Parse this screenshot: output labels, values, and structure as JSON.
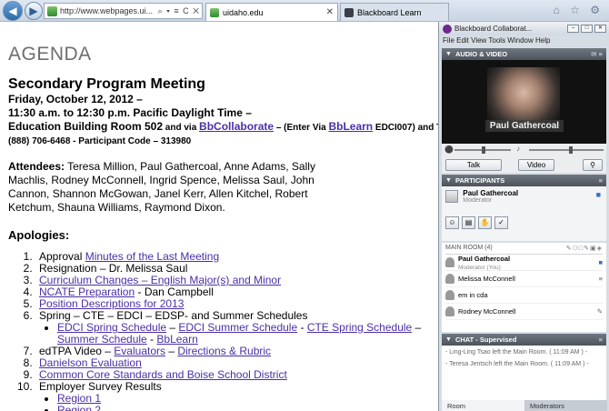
{
  "browser": {
    "back_icon": "back-arrow-icon",
    "forward_icon": "forward-arrow-icon",
    "address": "http://www.webpages.ui...",
    "address_controls": "⌕ ▾ ≡ C ✕",
    "tabs": [
      {
        "label": "uidaho.edu",
        "close": "✕"
      },
      {
        "label": "Blackboard Learn"
      }
    ],
    "toolbar_icons": "⌂ ☆ ⚙"
  },
  "page": {
    "title": "AGENDA",
    "meeting_title": "Secondary Program Meeting",
    "date_line": "Friday, October 12, 2012 –",
    "time_line": "11:30 a.m. to 12:30 p.m. Pacific Daylight Time –",
    "location_prefix": "Education Building Room 502",
    "location_via": " and via ",
    "location_link1": "BbCollaborate",
    "location_mid": " – (Enter Via ",
    "location_link2": "BbLearn",
    "location_suffix": " EDCI007) and T",
    "phone_line": "(888) 706-6468 - Participant Code – 313980",
    "attendees_label": "Attendees:",
    "attendees_text": " Teresa Million, Paul Gathercoal, Anne Adams, Sally Machlis, Rodney McConnell, Ingrid Spence, Melissa Saul, John Cannon, Shannon McGowan, Janel Kerr, Allen Kitchel, Robert Ketchum, Shauna Williams, Raymond Dixon.",
    "apologies_title": "Apologies:",
    "items": {
      "i1_text": "Approval ",
      "i1_link": "Minutes of the Last Meeting",
      "i2_text": "Resignation – Dr. Melissa Saul",
      "i3_link": "Curriculum Changes – English Major(s) and Minor",
      "i4_link": "NCATE Preparation",
      "i4_text": " - Dan Campbell",
      "i5_link": "Position Descriptions for 2013",
      "i6_text": "Spring – CTE – EDCI – EDSP- and Summer Schedules",
      "i6_sub_link1": "EDCI Spring Schedule",
      "i6_sep1": " – ",
      "i6_sub_link2": "EDCI Summer Schedule",
      "i6_sep2": " - ",
      "i6_sub_link3": "CTE Spring Schedule",
      "i6_sep3": " – ",
      "i6_sub_link4": "Summer Schedule",
      "i6_sep4": " - ",
      "i6_sub_link5": "BbLearn",
      "i7_text": "edTPA Video – ",
      "i7_link1": "Evaluators",
      "i7_sep": " – ",
      "i7_link2": "Directions & Rubric",
      "i8_link": "Danielson Evaluation",
      "i9_link": "Common Core Standards and Boise School District",
      "i10_text": "Employer Survey Results",
      "i10_sub1": "Region 1",
      "i10_sub2": "Region 2"
    }
  },
  "collaborate": {
    "window_title": "Blackboard Collaborat...",
    "menu": "File  Edit  View  Tools  Window  Help",
    "audio_video_hdr": "AUDIO & VIDEO",
    "video_name": "Paul Gathercoal",
    "talk": "Talk",
    "video": "Video",
    "participants_hdr": "PARTICIPANTS",
    "moderator_name": "Paul Gathercoal",
    "moderator_role": "Moderator",
    "main_room": "MAIN ROOM (4)",
    "room_participants": [
      {
        "name": "Paul Gathercoal",
        "role": "Moderator (You)"
      },
      {
        "name": "Melissa McConnell",
        "role": ""
      },
      {
        "name": "em in cda",
        "role": ""
      },
      {
        "name": "Rodney McConnell",
        "role": ""
      }
    ],
    "chat_hdr": "CHAT - Supervised",
    "chat_messages": [
      "- Ling-Ling Tsao left the Main Room. ( 11:09 AM ) -",
      "- Teresa Jentsch left the Main Room. ( 11:09 AM ) -"
    ],
    "bottom_tabs": [
      "Room",
      "Moderators"
    ],
    "colors": {
      "brand": "#6e2a8c",
      "header": "#4c535c"
    }
  }
}
